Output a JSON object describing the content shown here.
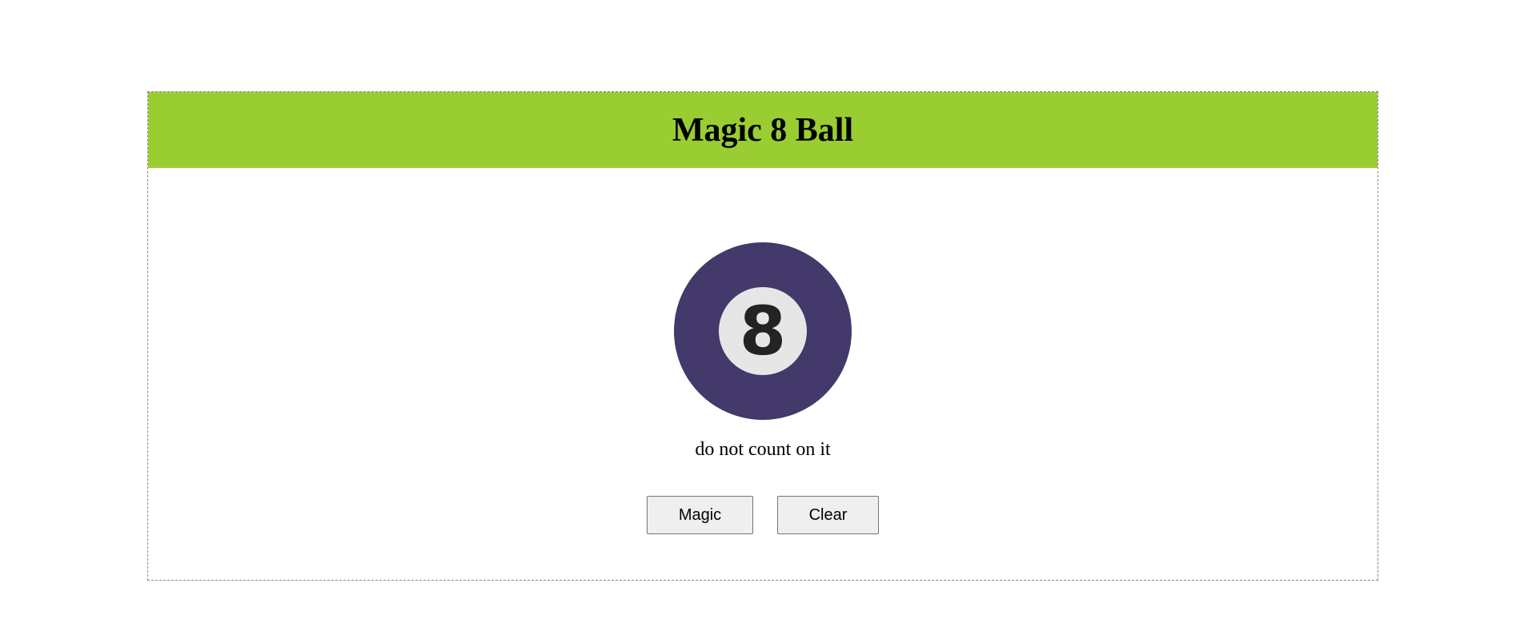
{
  "app": {
    "title": "Magic 8 Ball"
  },
  "ball": {
    "number": "8",
    "icon": "magic-8-ball-icon"
  },
  "answer": "do not count on it",
  "buttons": {
    "magic_label": "Magic",
    "clear_label": "Clear"
  },
  "colors": {
    "header_bg": "#9acd32",
    "ball_outer": "#43396b",
    "ball_inner": "#e6e6e6"
  }
}
